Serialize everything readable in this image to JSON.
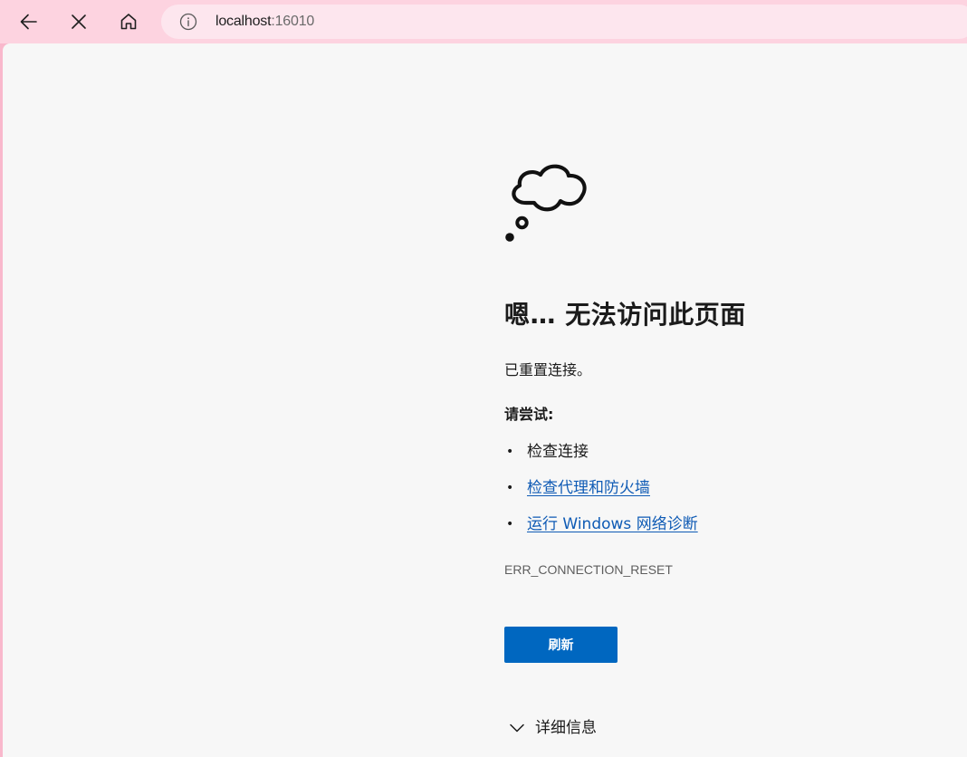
{
  "browser": {
    "address": {
      "host": "localhost",
      "port": ":16010"
    },
    "icons": {
      "back": "arrow-left-icon",
      "stop": "close-icon",
      "home": "home-icon",
      "info": "info-icon"
    }
  },
  "error_page": {
    "title": "嗯… 无法访问此页面",
    "subtitle": "已重置连接。",
    "try_label": "请尝试:",
    "suggestions": [
      {
        "text": "检查连接",
        "link": false
      },
      {
        "text": "检查代理和防火墙",
        "link": true
      },
      {
        "text": "运行 Windows 网络诊断",
        "link": true
      }
    ],
    "bullet": "•",
    "error_code": "ERR_CONNECTION_RESET",
    "refresh_label": "刷新",
    "details_label": "详细信息",
    "icons": {
      "illustration": "thought-cloud-icon",
      "expand": "chevron-down-icon"
    }
  },
  "colors": {
    "frame": "#f9b8cc",
    "toolbar": "#fdd3e0",
    "address_bar": "#fde6ee",
    "page_background": "#f7f7f7",
    "link": "#0f5bb5",
    "button": "#0067c0"
  }
}
